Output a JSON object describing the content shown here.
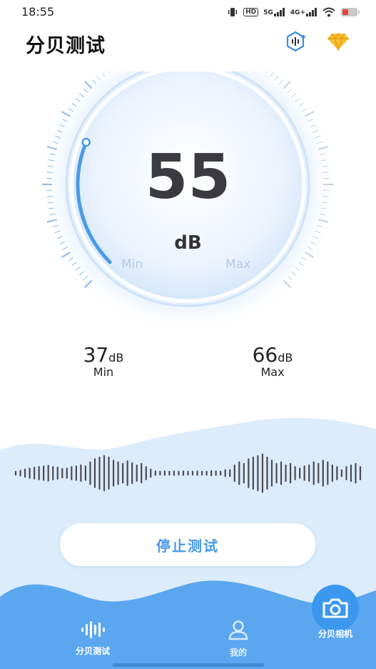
{
  "status_bar": {
    "time": "18:55",
    "hd_badge": "HD",
    "net_5g": "5G",
    "net_4g": "4G+",
    "icons": [
      "vibrate-icon",
      "signal-icon",
      "wifi-icon",
      "battery-icon"
    ]
  },
  "header": {
    "title": "分贝测试",
    "icons": [
      "sound-meter-icon",
      "diamond-vip-icon"
    ]
  },
  "gauge": {
    "value": "55",
    "unit": "dB",
    "min_label": "Min",
    "max_label": "Max",
    "level_fraction": 0.25
  },
  "stats": {
    "min": {
      "value": "37",
      "unit": "dB",
      "label": "Min"
    },
    "max": {
      "value": "66",
      "unit": "dB",
      "label": "Max"
    }
  },
  "waveform": {
    "amplitudes": [
      0.05,
      0.08,
      0.12,
      0.15,
      0.18,
      0.2,
      0.22,
      0.24,
      0.2,
      0.18,
      0.14,
      0.15,
      0.2,
      0.22,
      0.25,
      0.22,
      0.35,
      0.45,
      0.5,
      0.55,
      0.5,
      0.4,
      0.35,
      0.3,
      0.38,
      0.32,
      0.25,
      0.3,
      0.2,
      0.12,
      0.06,
      0.05,
      0.06,
      0.05,
      0.06,
      0.05,
      0.06,
      0.05,
      0.05,
      0.06,
      0.05,
      0.05,
      0.07,
      0.06,
      0.05,
      0.1,
      0.1,
      0.25,
      0.35,
      0.3,
      0.45,
      0.5,
      0.55,
      0.6,
      0.5,
      0.4,
      0.3,
      0.35,
      0.25,
      0.3,
      0.2,
      0.15,
      0.22,
      0.25,
      0.35,
      0.3,
      0.4,
      0.35,
      0.25,
      0.2,
      0.1,
      0.2,
      0.25,
      0.3,
      0.2
    ]
  },
  "actions": {
    "stop_label": "停止测试"
  },
  "bottom_nav": {
    "items": [
      {
        "label": "分贝测试",
        "icon": "sound-wave-icon"
      },
      {
        "label": "我的",
        "icon": "user-icon"
      }
    ],
    "camera": {
      "label": "分贝相机",
      "icon": "camera-icon"
    }
  },
  "colors": {
    "accent": "#4a9be8",
    "wave_back": "#dcecfb",
    "wave_front": "#5aa7ef",
    "camera_button": "#3b98ee"
  }
}
